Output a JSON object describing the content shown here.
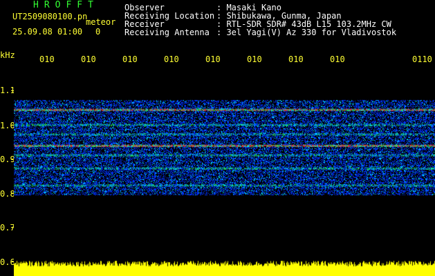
{
  "header": {
    "brand": "HROFFT",
    "file_name": "UT2509080100.pn",
    "datetime": "25.09.08 01:00",
    "count_label": "0",
    "mode_label": "meteor",
    "fields": [
      {
        "label": "Observer",
        "value": ": Masaki Kano"
      },
      {
        "label": "Receiving Location",
        "value": ": Shibukawa, Gunma, Japan"
      },
      {
        "label": "Receiver",
        "value": ": RTL-SDR SDR# 43dB L15 103.2MHz CW"
      },
      {
        "label": "Receiving Antenna",
        "value": ": 3el Yagi(V) Az 330 for Vladivostok"
      }
    ]
  },
  "axes": {
    "y_unit": "kHz",
    "y_ticks": [
      "1.1",
      "1.0",
      "0.9",
      "0.8",
      "0.7",
      "0.6"
    ],
    "x_ticks": [
      "010",
      "010",
      "010",
      "010",
      "010",
      "010",
      "010",
      "010",
      "010",
      "0110"
    ]
  },
  "spectrogram": {
    "freq_range_khz": [
      0.6,
      1.12
    ],
    "signal_band_khz": [
      0.775,
      1.025
    ],
    "strong_lines_khz": [
      1.0,
      0.905
    ],
    "medium_lines_khz": [
      0.96,
      0.935,
      0.88,
      0.845,
      0.8
    ],
    "colors": {
      "background": "#000000",
      "weak": "#0033ff",
      "mid": "#00ffff",
      "strong": "#33ff33",
      "peak": "#ff3333",
      "power_bar": "#ffff00"
    }
  }
}
